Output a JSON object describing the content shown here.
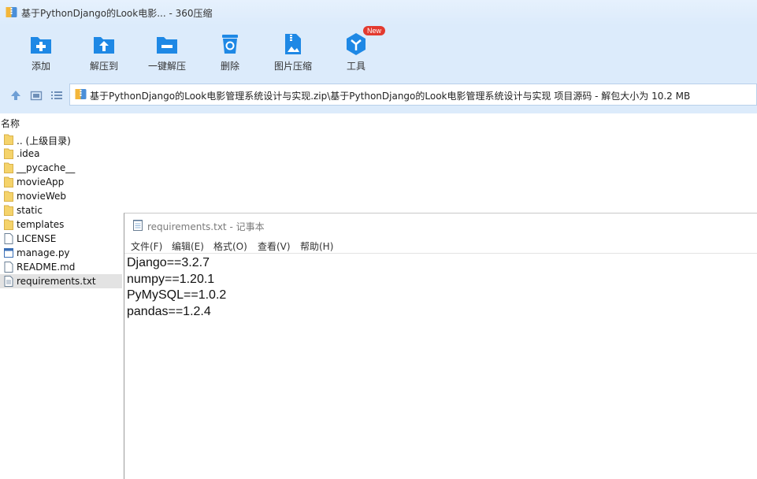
{
  "window": {
    "title": "基于PythonDjango的Look电影... - 360压缩",
    "icon": "archive-icon"
  },
  "toolbar": {
    "buttons": [
      {
        "label": "添加",
        "icon": "add-folder-icon"
      },
      {
        "label": "解压到",
        "icon": "extract-to-icon"
      },
      {
        "label": "一键解压",
        "icon": "one-click-extract-icon"
      },
      {
        "label": "删除",
        "icon": "trash-icon"
      },
      {
        "label": "图片压缩",
        "icon": "image-compress-icon"
      },
      {
        "label": "工具",
        "icon": "tools-icon",
        "badge": "New"
      }
    ]
  },
  "addressbar": {
    "path": "基于PythonDjango的Look电影管理系统设计与实现.zip\\基于PythonDjango的Look电影管理系统设计与实现 项目源码 - 解包大小为 10.2 MB"
  },
  "filelist": {
    "column_name": "名称",
    "items": [
      {
        "name": ".. (上级目录)",
        "type": "folder"
      },
      {
        "name": ".idea",
        "type": "folder"
      },
      {
        "name": "__pycache__",
        "type": "folder"
      },
      {
        "name": "movieApp",
        "type": "folder"
      },
      {
        "name": "movieWeb",
        "type": "folder"
      },
      {
        "name": "static",
        "type": "folder"
      },
      {
        "name": "templates",
        "type": "folder"
      },
      {
        "name": "LICENSE",
        "type": "file"
      },
      {
        "name": "manage.py",
        "type": "python"
      },
      {
        "name": "README.md",
        "type": "file"
      },
      {
        "name": "requirements.txt",
        "type": "text",
        "selected": true
      }
    ]
  },
  "notepad": {
    "title": "requirements.txt - 记事本",
    "menu": [
      "文件(F)",
      "编辑(E)",
      "格式(O)",
      "查看(V)",
      "帮助(H)"
    ],
    "lines": [
      "Django==3.2.7",
      "numpy==1.20.1",
      "PyMySQL==1.0.2",
      "pandas==1.2.4"
    ]
  },
  "colors": {
    "toolbar_bg": "#dcebfb",
    "icon_blue": "#1e88e5",
    "badge_red": "#e33a2f",
    "folder_yellow": "#f5d36b",
    "selected_row": "#e3e3e3"
  }
}
